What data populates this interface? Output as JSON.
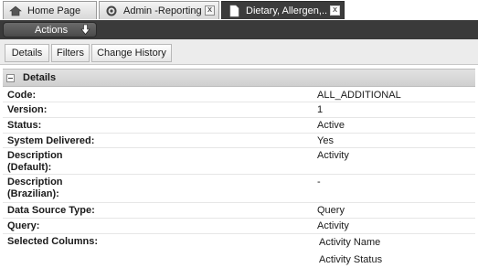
{
  "tabs": [
    {
      "label": "Home Page",
      "icon": "home-icon",
      "closable": false
    },
    {
      "label": "Admin -Reporting",
      "icon": "gear-icon",
      "closable": true
    },
    {
      "label": "Dietary, Allergen,..",
      "icon": "document-icon",
      "closable": true,
      "active": true
    }
  ],
  "tab_close_glyph": "x",
  "actions": {
    "label": "Actions",
    "icon": "down-arrow-icon"
  },
  "subtabs": [
    {
      "label": "Details"
    },
    {
      "label": "Filters"
    },
    {
      "label": "Change History"
    }
  ],
  "details": {
    "header": "Details",
    "rows": [
      {
        "label": "Code:",
        "value": "ALL_ADDITIONAL"
      },
      {
        "label": "Version:",
        "value": "1"
      },
      {
        "label": "Status:",
        "value": "Active"
      },
      {
        "label": "System Delivered:",
        "value": "Yes"
      },
      {
        "label": "Description (Default):",
        "value": "Activity"
      },
      {
        "label": "Description (Brazilian):",
        "value": "-"
      },
      {
        "label": "Data Source Type:",
        "value": "Query"
      },
      {
        "label": "Query:",
        "value": "Activity"
      },
      {
        "label": "Selected Columns:",
        "values": [
          "Activity Name",
          "Activity Status"
        ]
      }
    ]
  },
  "colors": {
    "actions_bar": "#3a3a3a",
    "active_tab": "#3c3c3c",
    "panel_header": "#d8d8d8"
  }
}
